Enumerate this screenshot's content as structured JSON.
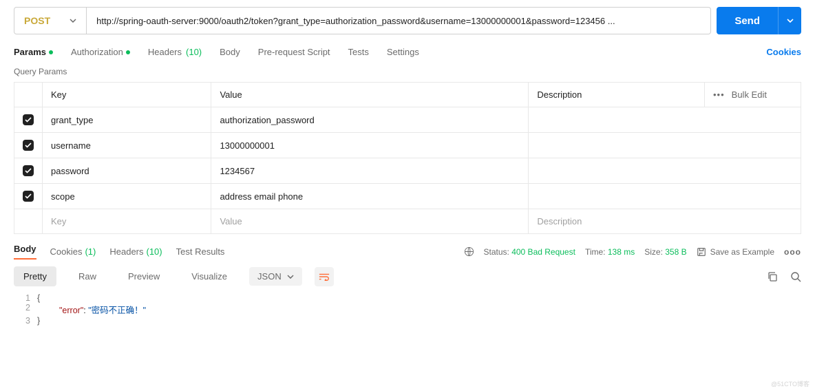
{
  "request": {
    "method": "POST",
    "url": "http://spring-oauth-server:9000/oauth2/token?grant_type=authorization_password&username=13000000001&password=123456 ...",
    "send_label": "Send"
  },
  "tabs": {
    "params": "Params",
    "authorization": "Authorization",
    "headers": "Headers",
    "headers_count": "(10)",
    "body": "Body",
    "prerequest": "Pre-request Script",
    "tests": "Tests",
    "settings": "Settings",
    "cookies": "Cookies"
  },
  "query_params": {
    "title": "Query Params",
    "header_key": "Key",
    "header_value": "Value",
    "header_desc": "Description",
    "bulk": "Bulk Edit",
    "placeholder_key": "Key",
    "placeholder_value": "Value",
    "placeholder_desc": "Description",
    "rows": [
      {
        "key": "grant_type",
        "value": "authorization_password",
        "desc": ""
      },
      {
        "key": "username",
        "value": "13000000001",
        "desc": ""
      },
      {
        "key": "password",
        "value": "1234567",
        "desc": ""
      },
      {
        "key": "scope",
        "value": "address email phone",
        "desc": ""
      }
    ]
  },
  "response": {
    "tabs": {
      "body": "Body",
      "cookies": "Cookies",
      "cookies_count": "(1)",
      "headers": "Headers",
      "headers_count": "(10)",
      "test_results": "Test Results"
    },
    "status_label": "Status:",
    "status_value": "400 Bad Request",
    "time_label": "Time:",
    "time_value": "138 ms",
    "size_label": "Size:",
    "size_value": "358 B",
    "save_as_example": "Save as Example",
    "view": {
      "pretty": "Pretty",
      "raw": "Raw",
      "preview": "Preview",
      "visualize": "Visualize",
      "format": "JSON"
    },
    "body_json": {
      "error": "密码不正确！"
    },
    "code_lines": {
      "l1": "{",
      "l2_key": "\"error\"",
      "l2_sep": ": ",
      "l2_val": "\"密码不正确！\"",
      "l3": "}"
    }
  },
  "watermark": "@51CTO博客"
}
